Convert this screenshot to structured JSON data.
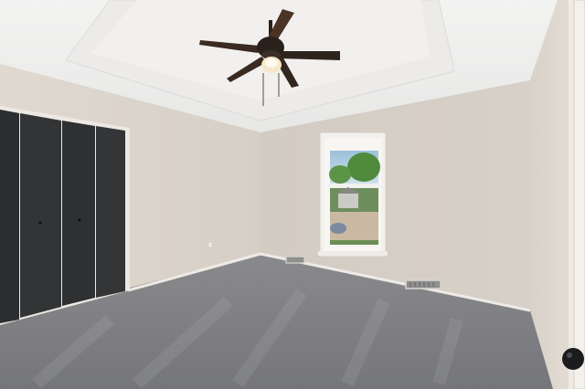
{
  "scene": {
    "subject": "empty-bedroom-interior",
    "elements": {
      "ceiling": "tray-ceiling",
      "fan": "ceiling-fan-with-light",
      "window": "double-hung-window",
      "closet": "bifold-closet-doors",
      "floor": "carpet",
      "vents": "floor-vents",
      "door": "door-edge-with-knob"
    }
  },
  "colors": {
    "wall": "#d9d2ca",
    "wall_shadow": "#cbc4bb",
    "wall_light": "#e4ded6",
    "ceiling": "#ededec",
    "carpet": "#7f7f82",
    "closet": "#2e2f31",
    "fan_blade": "#3d2c22",
    "trim": "#f2f0ec"
  }
}
